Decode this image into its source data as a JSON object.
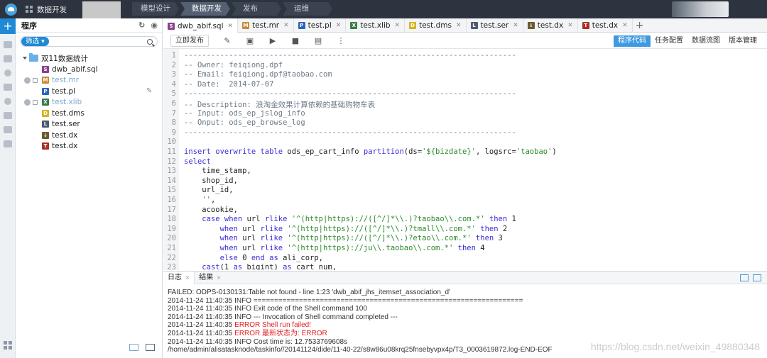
{
  "topbar": {
    "app_label": "数据开发",
    "nav": [
      "模型设计",
      "数据开发",
      "发布",
      "运维"
    ]
  },
  "sidebar": {
    "title": "程序",
    "filter_label": "筛选",
    "folder": "双11数据统计",
    "items": [
      {
        "name": "dwb_abif.sql",
        "icon": "sql-file-icon",
        "badge": "S",
        "color": "#8a3f8f",
        "dim": false
      },
      {
        "name": "test.mr",
        "icon": "mr-file-icon",
        "badge": "M",
        "color": "#c98b33",
        "dim": true
      },
      {
        "name": "test.pl",
        "icon": "pl-file-icon",
        "badge": "P",
        "color": "#2c66b8",
        "dim": false
      },
      {
        "name": "test.xlib",
        "icon": "xlib-file-icon",
        "badge": "X",
        "color": "#3c7a4a",
        "dim": true
      },
      {
        "name": "test.dms",
        "icon": "dms-file-icon",
        "badge": "D",
        "color": "#d7b21f",
        "dim": false
      },
      {
        "name": "test.ser",
        "icon": "ser-file-icon",
        "badge": "L",
        "color": "#4d5b6e",
        "dim": false
      },
      {
        "name": "test.dx",
        "icon": "dx-file-icon",
        "badge": "↓",
        "color": "#6d5a2e",
        "dim": false
      },
      {
        "name": "test.dx",
        "icon": "dx2-file-icon",
        "badge": "T",
        "color": "#a8302a",
        "dim": false
      }
    ]
  },
  "tabs": [
    {
      "label": "dwb_abif.sql",
      "badge": "S",
      "color": "#8a3f8f",
      "active": true
    },
    {
      "label": "test.mr",
      "badge": "M",
      "color": "#c98b33",
      "active": false
    },
    {
      "label": "test.pl",
      "badge": "P",
      "color": "#2c66b8",
      "active": false
    },
    {
      "label": "test.xlib",
      "badge": "X",
      "color": "#3c7a4a",
      "active": false
    },
    {
      "label": "test.dms",
      "badge": "D",
      "color": "#d7b21f",
      "active": false
    },
    {
      "label": "test.ser",
      "badge": "L",
      "color": "#4d5b6e",
      "active": false
    },
    {
      "label": "test.dx",
      "badge": "↓",
      "color": "#6d5a2e",
      "active": false
    },
    {
      "label": "test.dx",
      "badge": "T",
      "color": "#a8302a",
      "active": false
    }
  ],
  "toolbar": {
    "publish_label": "立即发布",
    "right_tabs": [
      "程序代码",
      "任务配置",
      "数据流图",
      "版本管理"
    ]
  },
  "code_lines": [
    {
      "n": "1",
      "segs": [
        [
          "com",
          "--------------------------------------------------------------------------"
        ]
      ]
    },
    {
      "n": "2",
      "segs": [
        [
          "com",
          "-- Owner: feiqiong.dpf"
        ]
      ]
    },
    {
      "n": "3",
      "segs": [
        [
          "com",
          "-- Email: feiqiong.dpf@taobao.com"
        ]
      ]
    },
    {
      "n": "4",
      "segs": [
        [
          "com",
          "-- Date:  2014-07-07"
        ]
      ]
    },
    {
      "n": "5",
      "segs": [
        [
          "com",
          "--------------------------------------------------------------------------"
        ]
      ]
    },
    {
      "n": "6",
      "segs": [
        [
          "com",
          "-- Description: 浪淘金效果计算依赖的基础购物车表"
        ]
      ]
    },
    {
      "n": "7",
      "segs": [
        [
          "com",
          "-- Input: ods_ep_jslog_info"
        ]
      ]
    },
    {
      "n": "8",
      "segs": [
        [
          "com",
          "-- Onput: ods_ep_browse_log"
        ]
      ]
    },
    {
      "n": "9",
      "segs": [
        [
          "com",
          "--------------------------------------------------------------------------"
        ]
      ]
    },
    {
      "n": "10",
      "segs": []
    },
    {
      "n": "11",
      "segs": [
        [
          "kw",
          "insert overwrite table "
        ],
        [
          "pl",
          "ods_ep_cart_info "
        ],
        [
          "kw",
          "partition"
        ],
        [
          "pl",
          "(ds="
        ],
        [
          "str",
          "'${bizdate}'"
        ],
        [
          "pl",
          ", logsrc="
        ],
        [
          "str",
          "'taobao'"
        ],
        [
          "pl",
          ")"
        ]
      ]
    },
    {
      "n": "12",
      "segs": [
        [
          "kw",
          "select"
        ]
      ]
    },
    {
      "n": "13",
      "segs": [
        [
          "pl",
          "    time_stamp,"
        ]
      ]
    },
    {
      "n": "14",
      "segs": [
        [
          "pl",
          "    shop_id,"
        ]
      ]
    },
    {
      "n": "15",
      "segs": [
        [
          "pl",
          "    url_id,"
        ]
      ]
    },
    {
      "n": "16",
      "segs": [
        [
          "pl",
          "    "
        ],
        [
          "str",
          "''"
        ],
        [
          "pl",
          ","
        ]
      ]
    },
    {
      "n": "17",
      "segs": [
        [
          "pl",
          "    acookie,"
        ]
      ]
    },
    {
      "n": "18",
      "segs": [
        [
          "pl",
          "    "
        ],
        [
          "kw",
          "case when "
        ],
        [
          "pl",
          "url "
        ],
        [
          "kw",
          "rlike "
        ],
        [
          "str",
          "'^(http|https)://([^/]*\\\\.)?taobao\\\\.com.*'"
        ],
        [
          "kw",
          " then "
        ],
        [
          "pl",
          "1"
        ]
      ]
    },
    {
      "n": "19",
      "segs": [
        [
          "pl",
          "        "
        ],
        [
          "kw",
          "when "
        ],
        [
          "pl",
          "url "
        ],
        [
          "kw",
          "rlike "
        ],
        [
          "str",
          "'^(http|https)://([^/]*\\\\.)?tmall\\\\.com.*'"
        ],
        [
          "kw",
          " then "
        ],
        [
          "pl",
          "2"
        ]
      ]
    },
    {
      "n": "20",
      "segs": [
        [
          "pl",
          "        "
        ],
        [
          "kw",
          "when "
        ],
        [
          "pl",
          "url "
        ],
        [
          "kw",
          "rlike "
        ],
        [
          "str",
          "'^(http|https)://([^/]*\\\\.)?etao\\\\.com.*'"
        ],
        [
          "kw",
          " then "
        ],
        [
          "pl",
          "3"
        ]
      ]
    },
    {
      "n": "21",
      "segs": [
        [
          "pl",
          "        "
        ],
        [
          "kw",
          "when "
        ],
        [
          "pl",
          "url "
        ],
        [
          "kw",
          "rlike "
        ],
        [
          "str",
          "'^(http|https)://ju\\\\.taobao\\\\.com.*'"
        ],
        [
          "kw",
          " then "
        ],
        [
          "pl",
          "4"
        ]
      ]
    },
    {
      "n": "22",
      "segs": [
        [
          "pl",
          "        "
        ],
        [
          "kw",
          "else "
        ],
        [
          "pl",
          "0 "
        ],
        [
          "kw",
          "end as "
        ],
        [
          "pl",
          "ali_corp,"
        ]
      ]
    },
    {
      "n": "23",
      "segs": [
        [
          "pl",
          "    "
        ],
        [
          "kw",
          "cast"
        ],
        [
          "pl",
          "(1 "
        ],
        [
          "kw",
          "as "
        ],
        [
          "pl",
          "bigint) "
        ],
        [
          "kw",
          "as "
        ],
        [
          "pl",
          "cart_num,"
        ]
      ]
    }
  ],
  "log": {
    "tabs": [
      "日志",
      "结果"
    ],
    "lines": [
      {
        "text": "FAILED: ODPS-0130131:Table not found - line 1:23 'dwb_abif_jhs_itemset_association_d'",
        "err": ""
      },
      {
        "text": "2014-11-24 11:40:35 INFO =================================================================",
        "err": ""
      },
      {
        "text": "2014-11-24 11:40:35 INFO Exit code of the Shell command 100",
        "err": ""
      },
      {
        "text": "2014-11-24 11:40:35 INFO --- Invocation of Shell command completed ---",
        "err": ""
      },
      {
        "text": "2014-11-24 11:40:35 ",
        "err": "ERROR Shell run failed!"
      },
      {
        "text": "2014-11-24 11:40:35 ",
        "err": "ERROR 最新状态为: ERROR"
      },
      {
        "text": "2014-11-24 11:40:35 INFO Cost time is: 12.7533769608s",
        "err": ""
      },
      {
        "text": "/home/admin/alisatasknode/taskinfo//20141124/dide/11-40-22/s8w86u08krq25fnsebyvpx4p/T3_0003619872.log-END-EOF",
        "err": ""
      }
    ]
  },
  "watermark": "https://blog.csdn.net/weixin_49880348"
}
